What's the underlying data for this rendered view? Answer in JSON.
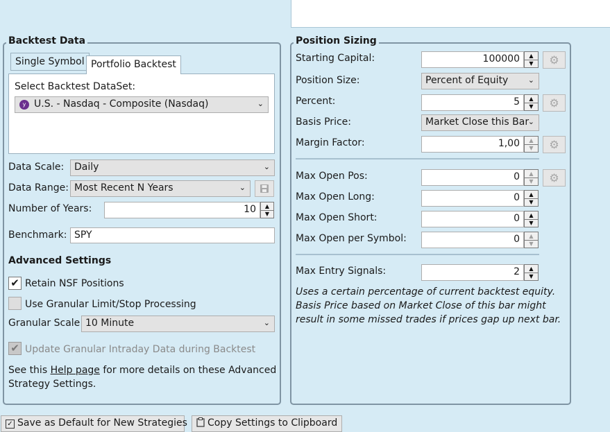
{
  "backtest": {
    "title": "Backtest Data",
    "tabs": [
      "Single Symbol",
      "Portfolio Backtest"
    ],
    "dataset_label": "Select Backtest DataSet:",
    "dataset_value": "U.S. - Nasdaq - Composite (Nasdaq)",
    "data_scale_label": "Data Scale:",
    "data_scale_value": "Daily",
    "data_range_label": "Data Range:",
    "data_range_value": "Most Recent N Years",
    "years_label": "Number of Years:",
    "years_value": "10",
    "benchmark_label": "Benchmark:",
    "benchmark_value": "SPY"
  },
  "advanced": {
    "title": "Advanced Settings",
    "retain_nsf": "Retain NSF Positions",
    "granular_processing": "Use Granular Limit/Stop Processing",
    "granular_scale_label": "Granular Scale",
    "granular_scale_value": "10 Minute",
    "update_granular": "Update Granular Intraday Data during Backtest",
    "help_prefix": "See this",
    "help_link": "Help page",
    "help_suffix_1": "for more details on these Advanced",
    "help_suffix_2": "Strategy Settings."
  },
  "sizing": {
    "title": "Position Sizing",
    "starting_capital_label": "Starting Capital:",
    "starting_capital_value": "100000",
    "position_size_label": "Position Size:",
    "position_size_value": "Percent of Equity",
    "percent_label": "Percent:",
    "percent_value": "5",
    "basis_price_label": "Basis Price:",
    "basis_price_value": "Market Close this Bar",
    "margin_label": "Margin Factor:",
    "margin_value": "1,00",
    "max_open_pos_label": "Max Open Pos:",
    "max_open_pos_value": "0",
    "max_open_long_label": "Max Open Long:",
    "max_open_long_value": "0",
    "max_open_short_label": "Max Open Short:",
    "max_open_short_value": "0",
    "max_open_symbol_label": "Max Open per Symbol:",
    "max_open_symbol_value": "0",
    "max_entry_label": "Max Entry Signals:",
    "max_entry_value": "2",
    "note_1": "Uses a certain percentage of current backtest equity.",
    "note_2": "Basis Price based on Market Close of this bar might",
    "note_3": "result in some missed trades if prices gap up next bar."
  },
  "footer": {
    "save_default": "Save as Default for New Strategies",
    "copy_settings": "Copy Settings to Clipboard"
  },
  "icons": {
    "caret": "chevron-down-icon",
    "gear": "gear-icon",
    "save": "save-icon",
    "checkbox": "checkmark-icon",
    "clipboard": "clipboard-icon"
  }
}
